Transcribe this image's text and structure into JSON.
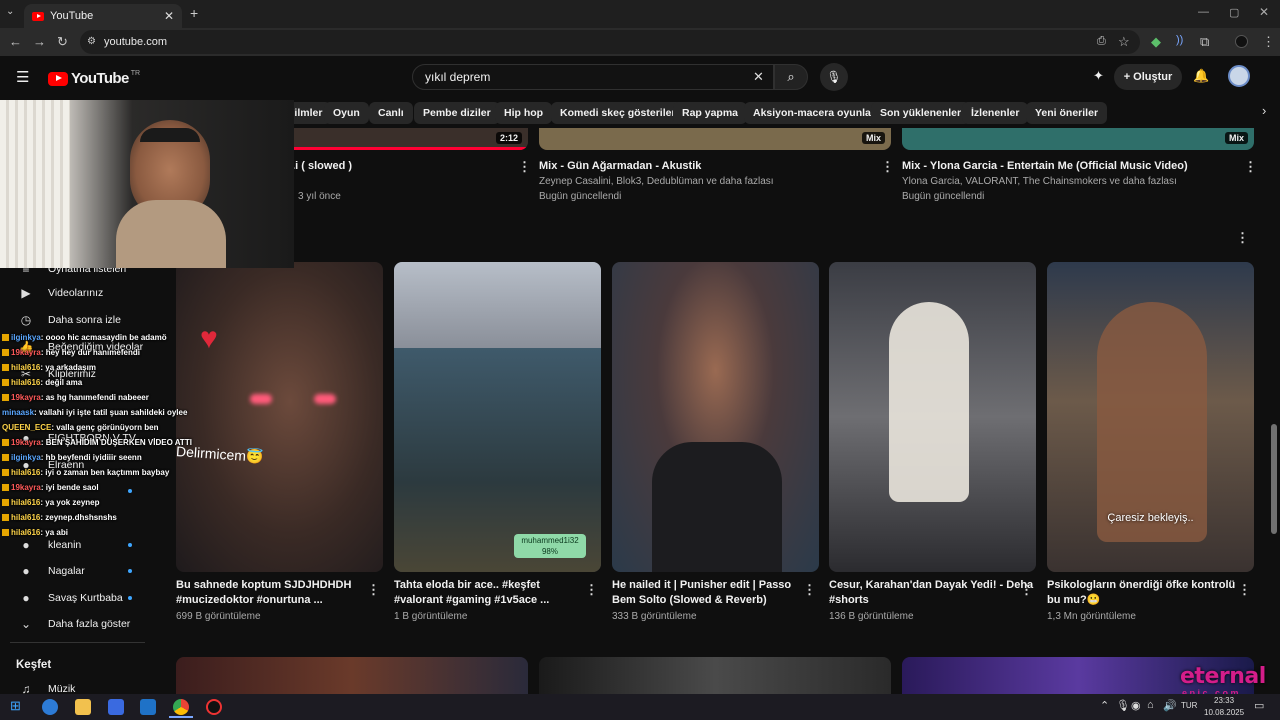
{
  "browser": {
    "tab_title": "YouTube",
    "tab_close": "✕",
    "new_tab": "+",
    "url": "youtube.com"
  },
  "header": {
    "logo_text": "YouTube",
    "logo_region": "TR",
    "search_value": "yıkıl deprem",
    "create_label": "Oluştur"
  },
  "chips": [
    "Filmler",
    "Oyun",
    "Canlı",
    "Pembe diziler",
    "Hip hop",
    "Komedi skeç gösterileri",
    "Rap yapma",
    "Aksiyon-macera oyunları",
    "Son yüklenenler",
    "İzlenenler",
    "Yeni öneriler"
  ],
  "sidebar": {
    "items": [
      {
        "label": "Oynatma listeleri",
        "icon": "playlist-icon"
      },
      {
        "label": "Videolarınız",
        "icon": "video-icon"
      },
      {
        "label": "Daha sonra izle",
        "icon": "clock-icon"
      },
      {
        "label": "Beğendiğim videolar",
        "icon": "like-icon"
      },
      {
        "label": "Kliplerimiz",
        "icon": "scissors-icon"
      }
    ],
    "subscriptions": [
      {
        "label": "FIGHTBORN V TV"
      },
      {
        "label": "Elraenn"
      },
      {
        "label": "kleanin"
      },
      {
        "label": "Nagalar"
      },
      {
        "label": "Savaş Kurtbaba"
      }
    ],
    "show_more": "Daha fazla göster",
    "explore_heading": "Keşfet",
    "music": "Müzik"
  },
  "top_row": [
    {
      "title": "...i ( slowed )",
      "meta1": "",
      "meta2": "3 yıl önce",
      "badge": "2:12"
    },
    {
      "title": "Mix - Gün Ağarmadan - Akustik",
      "meta1": "Zeynep Casalini, Blok3, Dedublüman ve daha fazlası",
      "meta2": "Bugün güncellendi",
      "badge": "Mix"
    },
    {
      "title": "Mix - Ylona Garcia - Entertain Me (Official Music Video)",
      "meta1": "Ylona Garcia, VALORANT, The Chainsmokers ve daha fazlası",
      "meta2": "Bugün güncellendi",
      "badge": "Mix"
    }
  ],
  "shorts": [
    {
      "title_line1": "Bu sahnede koptum SJDJHDHDH",
      "title_line2": "#mucizedoktor #onurtuna ...",
      "views": "699 B görüntüleme",
      "overlay": "Delirmicem😇"
    },
    {
      "title_line1": "Tahta eloda bir ace..  #keşfet",
      "title_line2": "#valorant #gaming #1v5ace ...",
      "views": "1 B görüntüleme",
      "overlay": "muhammed1i32 98%"
    },
    {
      "title_line1": "He nailed it | Punisher edit | Passo",
      "title_line2": "Bem Solto (Slowed & Reverb)",
      "views": "333 B görüntüleme",
      "overlay": ""
    },
    {
      "title_line1": "Cesur, Karahan'dan Dayak Yedi! - Deha",
      "title_line2": "#shorts",
      "views": "136 B görüntüleme",
      "overlay": ""
    },
    {
      "title_line1": "Psikologların önerdiği öfke kontrolü",
      "title_line2": "bu mu?😬",
      "views": "1,3 Mn görüntüleme",
      "overlay": "Çaresiz bekleyiş.."
    }
  ],
  "chat": [
    {
      "user": "ilginkya",
      "msg": ": oooo hic acmasaydin be adamö",
      "color": "blue"
    },
    {
      "user": "19kayra",
      "msg": ": hey hey dur hanımefendi",
      "color": "red"
    },
    {
      "user": "hilal616",
      "msg": ": ya arkadaşım",
      "color": "yellow"
    },
    {
      "user": "hilal616",
      "msg": ": değil ama",
      "color": "yellow"
    },
    {
      "user": "19kayra",
      "msg": ": as hg hanımefendi nabeeer",
      "color": "red"
    },
    {
      "user": "minaask",
      "msg": ": vallahi iyi işte tatil şuan sahildeki oylee",
      "color": "blue"
    },
    {
      "user": "QUEEN_ECE",
      "msg": ": valla genç görünüyorn ben",
      "color": "yellow"
    },
    {
      "user": "19kayra",
      "msg": ": BEN ŞAHİDİM DÜŞERKEN VİDEO ATTI",
      "color": "red"
    },
    {
      "user": "ilginkya",
      "msg": ": hb beyfendi iyidiiir seenn",
      "color": "blue"
    },
    {
      "user": "hilal616",
      "msg": ": iyi o zaman ben kaçtımm baybay",
      "color": "yellow"
    },
    {
      "user": "19kayra",
      "msg": ": iyi bende saol",
      "color": "red"
    },
    {
      "user": "hilal616",
      "msg": ": ya yok zeynep",
      "color": "yellow"
    },
    {
      "user": "hilal616",
      "msg": ": zeynep.dhshsnshs",
      "color": "yellow"
    },
    {
      "user": "hilal616",
      "msg": ": ya abi",
      "color": "yellow"
    }
  ],
  "watermark": {
    "line1": "eternal",
    "line2": "e p i c . c o m"
  },
  "taskbar": {
    "lang": "TUR",
    "time": "23:33",
    "date": "10.08.2025"
  }
}
